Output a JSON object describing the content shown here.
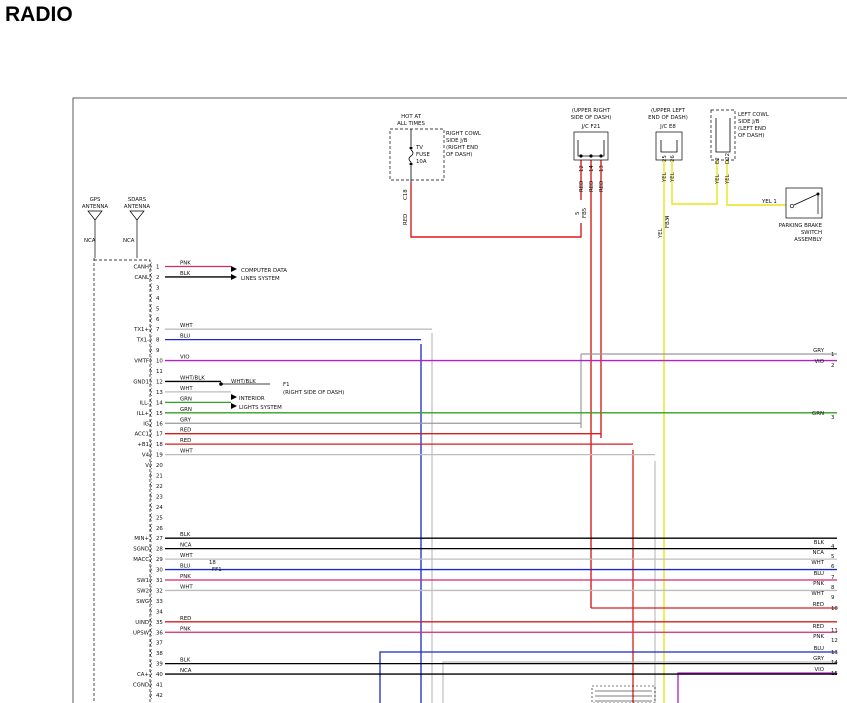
{
  "title": "RADIO",
  "labels": {
    "hot_at": "HOT AT",
    "all_times": "ALL TIMES",
    "rc_side": [
      "RIGHT COWL",
      "SIDE J/B",
      "(RIGHT END",
      "OF DASH)"
    ],
    "fuse": [
      "TV",
      "FUSE",
      "10A"
    ],
    "c18": "C18",
    "red_hot": "RED",
    "jc_f21": [
      "(UPPER RIGHT",
      "SIDE OF DASH)",
      "J/C F21"
    ],
    "jc_e8": [
      "(UPPER LEFT",
      "END OF DASH)",
      "J/C E8"
    ],
    "lc_side": [
      "LEFT COWL",
      "SIDE J/B",
      "(LEFT END",
      "OF DASH)"
    ],
    "parking": [
      "PARKING BRAKE",
      "SWITCH",
      "ASSEMBLY"
    ],
    "yel1": "YEL 1",
    "gps": [
      "GPS",
      "ANTENNA"
    ],
    "sdars": [
      "SDARS",
      "ANTENNA"
    ],
    "nca": "NCA",
    "computer": [
      "COMPUTER DATA",
      "LINES SYSTEM"
    ],
    "interior": [
      "INTERIOR",
      "LIGHTS SYSTEM"
    ],
    "f1": "F1",
    "f1_loc": "(RIGHT SIDE OF DASH)",
    "wht_blk_splice": "WHT/BLK",
    "ff1": "FF1",
    "ff1_num": "18",
    "fb5": "FB5",
    "fb3": "FB3"
  },
  "f21_pins": [
    "12",
    "14",
    "13"
  ],
  "f21_wires": [
    "RED",
    "RED",
    "RED"
  ],
  "e8_pins": [
    "25",
    "26"
  ],
  "e8_wires": [
    "YEL",
    "YEL"
  ],
  "lc_pins": [
    "E2",
    "D22"
  ],
  "lc_wires": [
    "YEL",
    "YEL"
  ],
  "fb5_wire": "RED",
  "fb5_pin": "5",
  "fb3_wire": "YEL",
  "fb3_pin": "4",
  "pins": [
    {
      "num": "1",
      "signal": "CANH",
      "wire": "PNK",
      "color": "#d6286b"
    },
    {
      "num": "2",
      "signal": "CANL",
      "wire": "BLK",
      "color": "#000000"
    },
    {
      "num": "3",
      "signal": "",
      "wire": "",
      "color": ""
    },
    {
      "num": "4",
      "signal": "",
      "wire": "",
      "color": ""
    },
    {
      "num": "5",
      "signal": "",
      "wire": "",
      "color": ""
    },
    {
      "num": "6",
      "signal": "",
      "wire": "",
      "color": ""
    },
    {
      "num": "7",
      "signal": "TX1+",
      "wire": "WHT",
      "color": "#bdbdbd"
    },
    {
      "num": "8",
      "signal": "TX1-",
      "wire": "BLU",
      "color": "#1c28c8"
    },
    {
      "num": "9",
      "signal": "",
      "wire": "",
      "color": ""
    },
    {
      "num": "10",
      "signal": "VMTF",
      "wire": "VIO",
      "color": "#b021c7"
    },
    {
      "num": "11",
      "signal": "",
      "wire": "",
      "color": ""
    },
    {
      "num": "12",
      "signal": "GND1",
      "wire": "WHT/BLK",
      "color": "#000000"
    },
    {
      "num": "13",
      "signal": "",
      "wire": "WHT",
      "color": "#bdbdbd"
    },
    {
      "num": "14",
      "signal": "ILL-",
      "wire": "GRN",
      "color": "#2fa321"
    },
    {
      "num": "15",
      "signal": "ILL+",
      "wire": "GRN",
      "color": "#2fa321"
    },
    {
      "num": "16",
      "signal": "IG",
      "wire": "GRY",
      "color": "#9a9a9a"
    },
    {
      "num": "17",
      "signal": "ACC1",
      "wire": "RED",
      "color": "#d61e1e"
    },
    {
      "num": "18",
      "signal": "+B1",
      "wire": "RED",
      "color": "#d61e1e"
    },
    {
      "num": "19",
      "signal": "V4",
      "wire": "WHT",
      "color": "#bdbdbd"
    },
    {
      "num": "20",
      "signal": "V",
      "wire": "",
      "color": ""
    },
    {
      "num": "21",
      "signal": "",
      "wire": "",
      "color": ""
    },
    {
      "num": "22",
      "signal": "",
      "wire": "",
      "color": ""
    },
    {
      "num": "23",
      "signal": "",
      "wire": "",
      "color": ""
    },
    {
      "num": "24",
      "signal": "",
      "wire": "",
      "color": ""
    },
    {
      "num": "25",
      "signal": "",
      "wire": "",
      "color": ""
    },
    {
      "num": "26",
      "signal": "",
      "wire": "",
      "color": ""
    },
    {
      "num": "27",
      "signal": "MIN+",
      "wire": "BLK",
      "color": "#000000"
    },
    {
      "num": "28",
      "signal": "SGND",
      "wire": "NCA",
      "color": "#000000"
    },
    {
      "num": "29",
      "signal": "MACC",
      "wire": "WHT",
      "color": "#bdbdbd"
    },
    {
      "num": "30",
      "signal": "",
      "wire": "BLU",
      "color": "#1c28c8"
    },
    {
      "num": "31",
      "signal": "SW1",
      "wire": "PNK",
      "color": "#d6286b"
    },
    {
      "num": "32",
      "signal": "SW2",
      "wire": "WHT",
      "color": "#bdbdbd"
    },
    {
      "num": "33",
      "signal": "SWG",
      "wire": "",
      "color": ""
    },
    {
      "num": "34",
      "signal": "",
      "wire": "",
      "color": ""
    },
    {
      "num": "35",
      "signal": "UIND",
      "wire": "RED",
      "color": "#d61e1e"
    },
    {
      "num": "36",
      "signal": "UPSW",
      "wire": "PNK",
      "color": "#d6286b"
    },
    {
      "num": "37",
      "signal": "",
      "wire": "",
      "color": ""
    },
    {
      "num": "38",
      "signal": "",
      "wire": "",
      "color": ""
    },
    {
      "num": "39",
      "signal": "",
      "wire": "BLK",
      "color": "#000000"
    },
    {
      "num": "40",
      "signal": "CA+",
      "wire": "NCA",
      "color": "#000000"
    },
    {
      "num": "41",
      "signal": "CGND",
      "wire": "",
      "color": ""
    },
    {
      "num": "42",
      "signal": "",
      "wire": "",
      "color": ""
    }
  ],
  "right_pins": [
    {
      "num": "1",
      "wire": "GRY"
    },
    {
      "num": "2",
      "wire": "VIO"
    },
    {
      "num": "3",
      "wire": "GRN"
    },
    {
      "num": "4",
      "wire": "BLK"
    },
    {
      "num": "5",
      "wire": "NCA"
    },
    {
      "num": "6",
      "wire": "WHT"
    },
    {
      "num": "7",
      "wire": "BLU"
    },
    {
      "num": "8",
      "wire": "PNK"
    },
    {
      "num": "9",
      "wire": "WHT"
    },
    {
      "num": "10",
      "wire": "RED"
    },
    {
      "num": "11",
      "wire": "RED"
    },
    {
      "num": "12",
      "wire": "PNK"
    },
    {
      "num": "13",
      "wire": "BLU"
    },
    {
      "num": "14",
      "wire": "GRY"
    },
    {
      "num": "15",
      "wire": "VIO"
    }
  ],
  "colors": {
    "red": "#d61e1e",
    "pink": "#d6286b",
    "blue": "#1c28c8",
    "violet": "#b021c7",
    "green": "#2fa321",
    "gray": "#9a9a9a",
    "white": "#bdbdbd",
    "yellow": "#e8e41c",
    "black": "#000000"
  }
}
